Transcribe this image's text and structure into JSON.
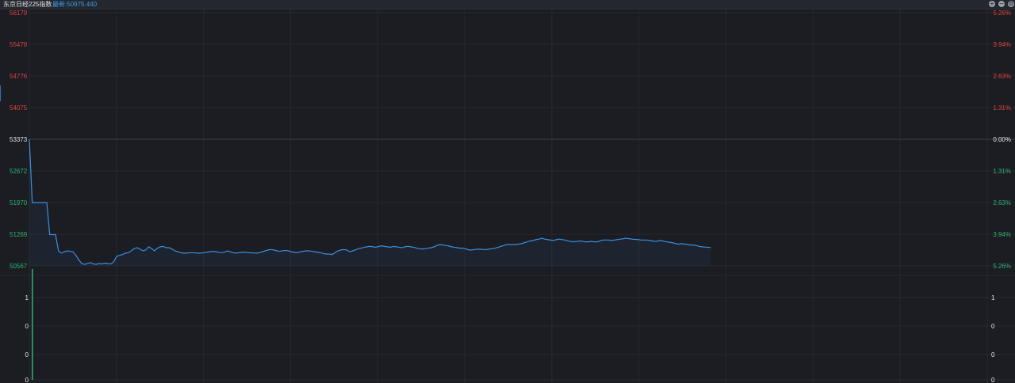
{
  "header": {
    "title": "东京日经225指数",
    "latest_label": "最新:50975.440",
    "zoom_in_icon": "+",
    "zoom_out_icon": "−",
    "settings_icon": "⚙"
  },
  "colors": {
    "up": "#e0413f",
    "down": "#2fb36f",
    "neutral": "#e6e6e6",
    "line": "#3a8fe0",
    "grid": "#262930",
    "background": "#1b1d22"
  },
  "chart_data": [
    {
      "type": "line",
      "title": "东京日经225指数",
      "ylim": [
        50567,
        56179
      ],
      "reference": 53373,
      "y_ticks": [
        "56179",
        "55478",
        "54776",
        "54075",
        "53373",
        "52672",
        "51970",
        "51269",
        "50567"
      ],
      "y_tick_values": [
        56179,
        55478,
        54776,
        54075,
        53373,
        52672,
        51970,
        51269,
        50567
      ],
      "pct_ticks": [
        "5.26%",
        "3.94%",
        "2.63%",
        "1.31%",
        "0.00%",
        "1.31%",
        "2.63%",
        "3.94%",
        "5.26%"
      ],
      "tick_trend": [
        "up",
        "up",
        "up",
        "up",
        "neutral",
        "down",
        "down",
        "down",
        "down"
      ],
      "total_points": 330,
      "series": [
        {
          "values": [
            53373,
            51970,
            51970,
            51970,
            51970,
            51970,
            51970,
            51260,
            51260,
            51260,
            50900,
            50850,
            50880,
            50900,
            50890,
            50880,
            50800,
            50700,
            50620,
            50600,
            50620,
            50640,
            50610,
            50600,
            50620,
            50610,
            50630,
            50615,
            50610,
            50660,
            50780,
            50800,
            50820,
            50850,
            50860,
            50900,
            50950,
            50970,
            50940,
            50900,
            50920,
            50990,
            50950,
            50900,
            50960,
            50990,
            51000,
            50970,
            50970,
            50940,
            50900,
            50880,
            50860,
            50850,
            50850,
            50860,
            50860,
            50855,
            50850,
            50850,
            50860,
            50870,
            50880,
            50890,
            50885,
            50870,
            50860,
            50870,
            50900,
            50880,
            50860,
            50850,
            50860,
            50870,
            50870,
            50860,
            50860,
            50855,
            50850,
            50860,
            50880,
            50900,
            50920,
            50930,
            50920,
            50900,
            50890,
            50900,
            50910,
            50900,
            50880,
            50870,
            50860,
            50880,
            50890,
            50900,
            50900,
            50890,
            50880,
            50870,
            50860,
            50840,
            50830,
            50830,
            50820,
            50860,
            50900,
            50920,
            50930,
            50920,
            50880,
            50900,
            50920,
            50950,
            50960,
            50980,
            50990,
            51000,
            50990,
            50980,
            51000,
            51010,
            51000,
            50990,
            50980,
            51000,
            50990,
            50980,
            50970,
            50990,
            51000,
            50990,
            50980,
            50960,
            50950,
            50940,
            50950,
            50960,
            50970,
            50990,
            51020,
            51040,
            51030,
            51020,
            51010,
            50990,
            50980,
            50970,
            50960,
            50960,
            50940,
            50920,
            50920,
            50930,
            50940,
            50935,
            50930,
            50930,
            50940,
            50950,
            50960,
            50980,
            51000,
            51020,
            51040,
            51040,
            51040,
            51040,
            51050,
            51060,
            51080,
            51100,
            51120,
            51130,
            51150,
            51160,
            51180,
            51160,
            51150,
            51140,
            51130,
            51150,
            51160,
            51150,
            51140,
            51120,
            51110,
            51100,
            51110,
            51120,
            51110,
            51100,
            51100,
            51110,
            51100,
            51100,
            51120,
            51140,
            51140,
            51140,
            51130,
            51140,
            51150,
            51160,
            51170,
            51180,
            51170,
            51160,
            51155,
            51150,
            51140,
            51140,
            51140,
            51130,
            51120,
            51110,
            51120,
            51130,
            51110,
            51100,
            51090,
            51080,
            51060,
            51050,
            51060,
            51050,
            51040,
            51030,
            51030,
            51020,
            51000,
            50990,
            50985,
            50980,
            50975
          ]
        }
      ]
    },
    {
      "type": "bar",
      "y_ticks": [
        "1",
        "0",
        "0",
        "0"
      ],
      "series": [
        {
          "values": [
            1,
            0,
            0,
            0
          ]
        }
      ]
    }
  ]
}
